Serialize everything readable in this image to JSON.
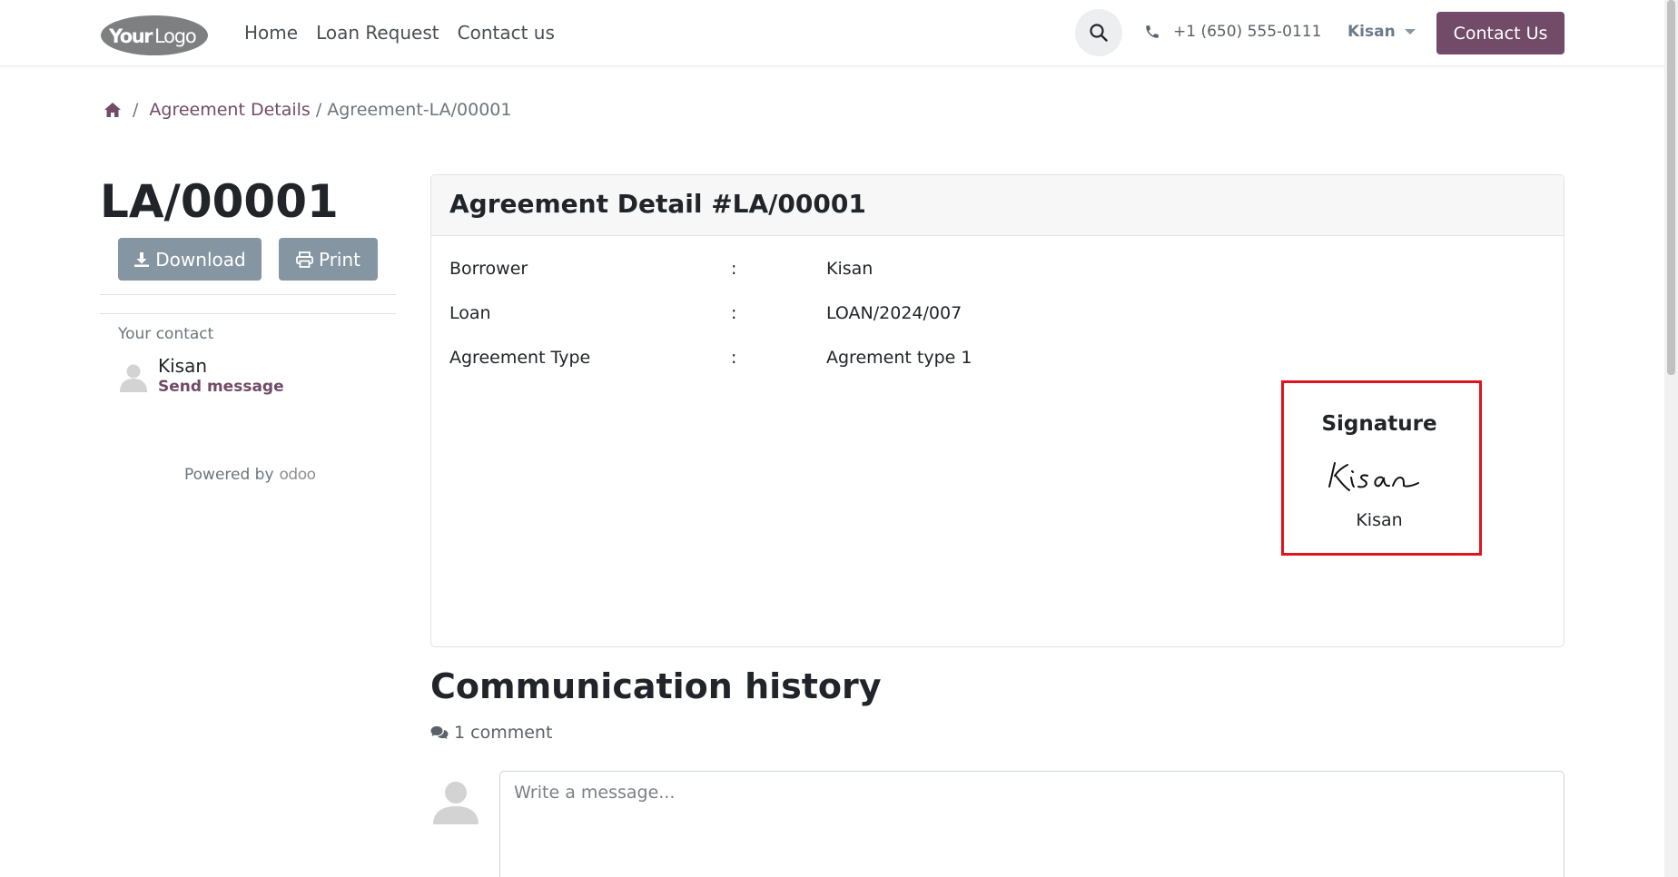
{
  "header": {
    "logo_text": "YourLogo",
    "nav": [
      "Home",
      "Loan Request",
      "Contact us"
    ],
    "phone": "+1 (650) 555-0111",
    "user": "Kisan",
    "contact_button": "Contact Us",
    "accent_color": "#714b67"
  },
  "breadcrumb": {
    "sep1": "/",
    "link": "Agreement Details",
    "sep2": "/",
    "active": "Agreement-LA/00001"
  },
  "sidebar": {
    "title": "LA/00001",
    "download": "Download",
    "print": "Print",
    "your_contact": "Your contact",
    "contact_name": "Kisan",
    "send_message": "Send message",
    "powered_by": "Powered by",
    "powered_brand": "odoo"
  },
  "card": {
    "title": "Agreement Detail #LA/00001",
    "rows": [
      {
        "label": "Borrower",
        "colon": ":",
        "value": "Kisan"
      },
      {
        "label": "Loan",
        "colon": ":",
        "value": "LOAN/2024/007"
      },
      {
        "label": "Agreement Type",
        "colon": ":",
        "value": "Agrement type 1"
      }
    ],
    "signature": {
      "title": "Signature",
      "image_text": "Kisan",
      "name": "Kisan",
      "highlight_color": "#e0141e"
    }
  },
  "communication": {
    "title": "Communication history",
    "count": "1 comment",
    "placeholder": "Write a message..."
  }
}
